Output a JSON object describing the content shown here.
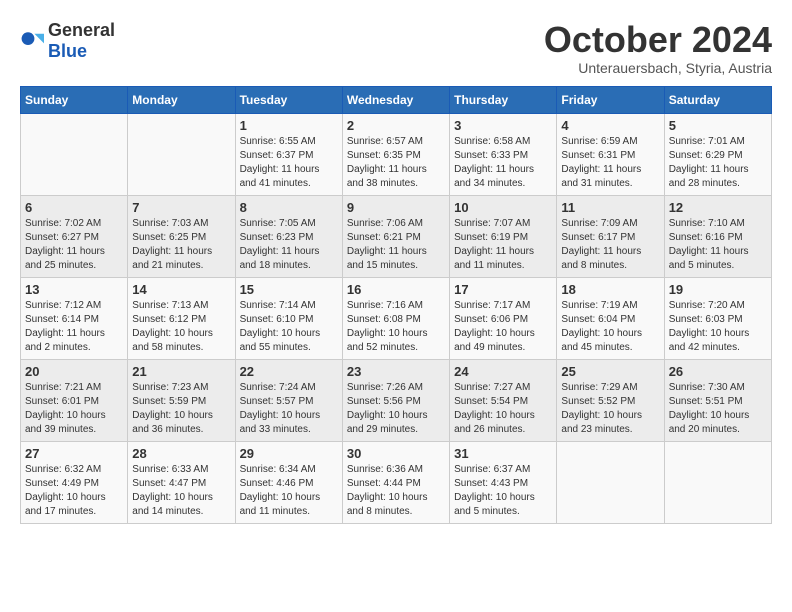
{
  "logo": {
    "general": "General",
    "blue": "Blue"
  },
  "title": "October 2024",
  "subtitle": "Unterauersbach, Styria, Austria",
  "days_header": [
    "Sunday",
    "Monday",
    "Tuesday",
    "Wednesday",
    "Thursday",
    "Friday",
    "Saturday"
  ],
  "weeks": [
    [
      {
        "day": "",
        "detail": ""
      },
      {
        "day": "",
        "detail": ""
      },
      {
        "day": "1",
        "detail": "Sunrise: 6:55 AM\nSunset: 6:37 PM\nDaylight: 11 hours and 41 minutes."
      },
      {
        "day": "2",
        "detail": "Sunrise: 6:57 AM\nSunset: 6:35 PM\nDaylight: 11 hours and 38 minutes."
      },
      {
        "day": "3",
        "detail": "Sunrise: 6:58 AM\nSunset: 6:33 PM\nDaylight: 11 hours and 34 minutes."
      },
      {
        "day": "4",
        "detail": "Sunrise: 6:59 AM\nSunset: 6:31 PM\nDaylight: 11 hours and 31 minutes."
      },
      {
        "day": "5",
        "detail": "Sunrise: 7:01 AM\nSunset: 6:29 PM\nDaylight: 11 hours and 28 minutes."
      }
    ],
    [
      {
        "day": "6",
        "detail": "Sunrise: 7:02 AM\nSunset: 6:27 PM\nDaylight: 11 hours and 25 minutes."
      },
      {
        "day": "7",
        "detail": "Sunrise: 7:03 AM\nSunset: 6:25 PM\nDaylight: 11 hours and 21 minutes."
      },
      {
        "day": "8",
        "detail": "Sunrise: 7:05 AM\nSunset: 6:23 PM\nDaylight: 11 hours and 18 minutes."
      },
      {
        "day": "9",
        "detail": "Sunrise: 7:06 AM\nSunset: 6:21 PM\nDaylight: 11 hours and 15 minutes."
      },
      {
        "day": "10",
        "detail": "Sunrise: 7:07 AM\nSunset: 6:19 PM\nDaylight: 11 hours and 11 minutes."
      },
      {
        "day": "11",
        "detail": "Sunrise: 7:09 AM\nSunset: 6:17 PM\nDaylight: 11 hours and 8 minutes."
      },
      {
        "day": "12",
        "detail": "Sunrise: 7:10 AM\nSunset: 6:16 PM\nDaylight: 11 hours and 5 minutes."
      }
    ],
    [
      {
        "day": "13",
        "detail": "Sunrise: 7:12 AM\nSunset: 6:14 PM\nDaylight: 11 hours and 2 minutes."
      },
      {
        "day": "14",
        "detail": "Sunrise: 7:13 AM\nSunset: 6:12 PM\nDaylight: 10 hours and 58 minutes."
      },
      {
        "day": "15",
        "detail": "Sunrise: 7:14 AM\nSunset: 6:10 PM\nDaylight: 10 hours and 55 minutes."
      },
      {
        "day": "16",
        "detail": "Sunrise: 7:16 AM\nSunset: 6:08 PM\nDaylight: 10 hours and 52 minutes."
      },
      {
        "day": "17",
        "detail": "Sunrise: 7:17 AM\nSunset: 6:06 PM\nDaylight: 10 hours and 49 minutes."
      },
      {
        "day": "18",
        "detail": "Sunrise: 7:19 AM\nSunset: 6:04 PM\nDaylight: 10 hours and 45 minutes."
      },
      {
        "day": "19",
        "detail": "Sunrise: 7:20 AM\nSunset: 6:03 PM\nDaylight: 10 hours and 42 minutes."
      }
    ],
    [
      {
        "day": "20",
        "detail": "Sunrise: 7:21 AM\nSunset: 6:01 PM\nDaylight: 10 hours and 39 minutes."
      },
      {
        "day": "21",
        "detail": "Sunrise: 7:23 AM\nSunset: 5:59 PM\nDaylight: 10 hours and 36 minutes."
      },
      {
        "day": "22",
        "detail": "Sunrise: 7:24 AM\nSunset: 5:57 PM\nDaylight: 10 hours and 33 minutes."
      },
      {
        "day": "23",
        "detail": "Sunrise: 7:26 AM\nSunset: 5:56 PM\nDaylight: 10 hours and 29 minutes."
      },
      {
        "day": "24",
        "detail": "Sunrise: 7:27 AM\nSunset: 5:54 PM\nDaylight: 10 hours and 26 minutes."
      },
      {
        "day": "25",
        "detail": "Sunrise: 7:29 AM\nSunset: 5:52 PM\nDaylight: 10 hours and 23 minutes."
      },
      {
        "day": "26",
        "detail": "Sunrise: 7:30 AM\nSunset: 5:51 PM\nDaylight: 10 hours and 20 minutes."
      }
    ],
    [
      {
        "day": "27",
        "detail": "Sunrise: 6:32 AM\nSunset: 4:49 PM\nDaylight: 10 hours and 17 minutes."
      },
      {
        "day": "28",
        "detail": "Sunrise: 6:33 AM\nSunset: 4:47 PM\nDaylight: 10 hours and 14 minutes."
      },
      {
        "day": "29",
        "detail": "Sunrise: 6:34 AM\nSunset: 4:46 PM\nDaylight: 10 hours and 11 minutes."
      },
      {
        "day": "30",
        "detail": "Sunrise: 6:36 AM\nSunset: 4:44 PM\nDaylight: 10 hours and 8 minutes."
      },
      {
        "day": "31",
        "detail": "Sunrise: 6:37 AM\nSunset: 4:43 PM\nDaylight: 10 hours and 5 minutes."
      },
      {
        "day": "",
        "detail": ""
      },
      {
        "day": "",
        "detail": ""
      }
    ]
  ]
}
